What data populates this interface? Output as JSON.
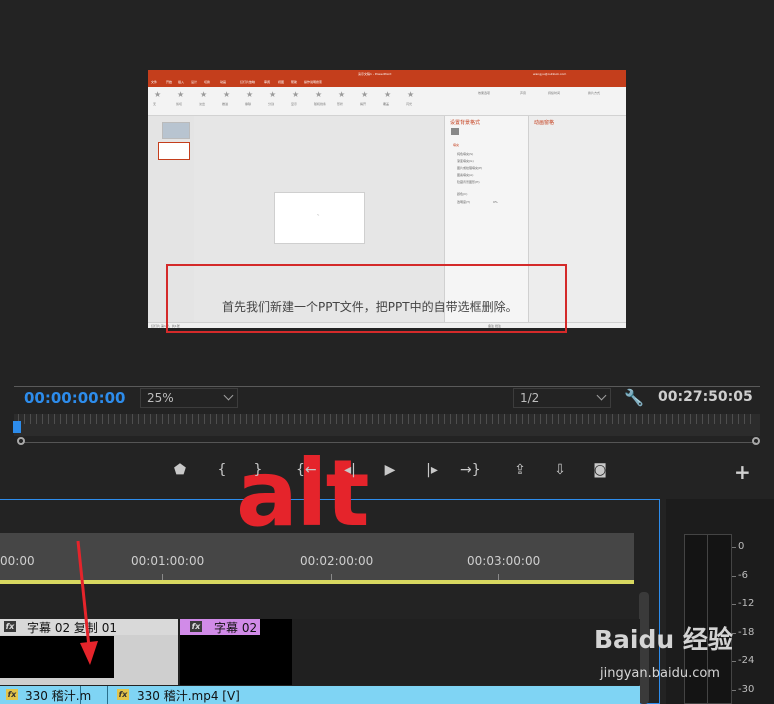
{
  "embedded_ppt": {
    "window_title": "演示文稿1 - PowerPoint",
    "user_email": "wangyu@outlook.com",
    "tabs": [
      "文件",
      "开始",
      "插入",
      "设计",
      "切换",
      "动画",
      "幻灯片放映",
      "审阅",
      "视图",
      "帮助",
      "操作说明搜索"
    ],
    "ribbon_items": [
      "无",
      "剪切",
      "淡出",
      "推进",
      "擦除",
      "分割",
      "显示",
      "随机线条",
      "形状",
      "揭开",
      "覆盖",
      "闪光"
    ],
    "effect_options": "效果选项",
    "sound_label": "声音",
    "duration_label": "持续时间",
    "advance_label": "换片方式",
    "format_pane_title": "设置背景格式",
    "fill_header": "填充",
    "fill_options": [
      "纯色填充(S)",
      "渐变填充(G)",
      "图片或纹理填充(P)",
      "图案填充(A)",
      "隐藏背景图形(H)"
    ],
    "color_label": "颜色(C)",
    "transparency_label": "透明度(T)",
    "transparency_value": "0%",
    "anim_pane_title": "动画窗格",
    "status_left": "幻灯片 第1张，共1张",
    "status_right": "备注  批注",
    "caption": "首先我们新建一个PPT文件，把PPT中的自带选框删除。"
  },
  "monitor": {
    "timecode_current": "00:00:00:00",
    "zoom_value": "25%",
    "resolution_value": "1/2",
    "timecode_duration": "00:27:50:05",
    "wrench_icon": "wrench-icon",
    "add_icon": "+"
  },
  "transport": [
    {
      "name": "add-marker-button",
      "glyph": "⬟"
    },
    {
      "name": "mark-in-button",
      "glyph": "{"
    },
    {
      "name": "mark-out-button",
      "glyph": "}"
    },
    {
      "name": "go-to-in-button",
      "glyph": "{←"
    },
    {
      "name": "step-back-button",
      "glyph": "◂|"
    },
    {
      "name": "play-button",
      "glyph": "▶"
    },
    {
      "name": "step-forward-button",
      "glyph": "|▸"
    },
    {
      "name": "go-to-out-button",
      "glyph": "→}"
    },
    {
      "name": "lift-button",
      "glyph": "⇪"
    },
    {
      "name": "extract-button",
      "glyph": "⇩"
    },
    {
      "name": "export-frame-button",
      "glyph": "◙"
    }
  ],
  "timeline": {
    "times": [
      "00:00",
      "00:01:00:00",
      "00:02:00:00",
      "00:03:00:00"
    ],
    "clip_a_label": "字幕 02 复制 01",
    "clip_b_label": "字幕 02",
    "video_a_label": "330 稽汁.m",
    "video_b_label": "330 稽汁.mp4 [V]",
    "fx": "fx"
  },
  "meter": {
    "db_labels": [
      "0",
      "-6",
      "-12",
      "-18",
      "-24",
      "-30"
    ]
  },
  "overlay": {
    "annotation": "alt",
    "watermark_brand": "Baidu 经验",
    "watermark_url": "jingyan.baidu.com"
  },
  "colors": {
    "accent_blue": "#2d8ceb",
    "annotation_red": "#e5242b",
    "ppt_orange": "#c43e1c",
    "clip_pink": "#d18be8",
    "clip_cyan": "#7fd4f4",
    "work_area_yellow": "#d8d860"
  }
}
